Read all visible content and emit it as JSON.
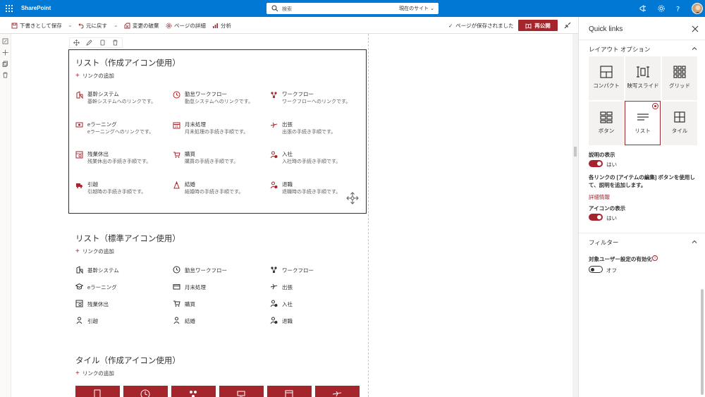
{
  "topbar": {
    "brand": "SharePoint",
    "search_placeholder": "検索",
    "search_scope": "現在のサイト"
  },
  "cmdbar": {
    "save_draft": "下書きとして保存",
    "undo": "元に戻す",
    "discard": "変更の破棄",
    "page_details": "ページの詳細",
    "analytics": "分析",
    "saved_status": "ページが保存されました",
    "republish": "再公開"
  },
  "section1": {
    "title": "リスト（作成アイコン使用）",
    "add_link": "リンクの追加",
    "items": [
      {
        "title": "基幹システム",
        "desc": "基幹システムへのリンクです。",
        "icon": "building-icon"
      },
      {
        "title": "勤怠ワークフロー",
        "desc": "勤怠システムへのリンクです。",
        "icon": "clock-icon"
      },
      {
        "title": "ワークフロー",
        "desc": "ワークフローへのリンクです。",
        "icon": "workflow-icon"
      },
      {
        "title": "eラーニング",
        "desc": "eラーニングへのリンクです。",
        "icon": "elearning-icon"
      },
      {
        "title": "月末処理",
        "desc": "月末処理の手続き手順です。",
        "icon": "calendar-icon"
      },
      {
        "title": "出張",
        "desc": "出張の手続き手順です。",
        "icon": "airplane-icon"
      },
      {
        "title": "残業休出",
        "desc": "残業休出の手続き手順です。",
        "icon": "overtime-icon"
      },
      {
        "title": "購買",
        "desc": "購買の手続き手順です。",
        "icon": "cart-icon"
      },
      {
        "title": "入社",
        "desc": "入社時の手続き手順です。",
        "icon": "person-add-icon"
      },
      {
        "title": "引越",
        "desc": "引越時の手続き手順です。",
        "icon": "truck-icon"
      },
      {
        "title": "結婚",
        "desc": "結婚時の手続き手順です。",
        "icon": "wedding-icon"
      },
      {
        "title": "退職",
        "desc": "退職時の手続き手順です。",
        "icon": "person-remove-icon"
      }
    ]
  },
  "section2": {
    "title": "リスト（標準アイコン使用）",
    "add_link": "リンクの追加",
    "items": [
      {
        "title": "基幹システム",
        "icon": "building-icon"
      },
      {
        "title": "勤怠ワークフロー",
        "icon": "clock-icon"
      },
      {
        "title": "ワークフロー",
        "icon": "workflow-icon"
      },
      {
        "title": "eラーニング",
        "icon": "graduation-cap-icon"
      },
      {
        "title": "月末処理",
        "icon": "card-icon"
      },
      {
        "title": "出張",
        "icon": "airplane-icon"
      },
      {
        "title": "残業休出",
        "icon": "overtime-icon"
      },
      {
        "title": "購買",
        "icon": "cart-icon"
      },
      {
        "title": "入社",
        "icon": "person-add-icon"
      },
      {
        "title": "引越",
        "icon": "person-icon"
      },
      {
        "title": "結婚",
        "icon": "person-icon"
      },
      {
        "title": "退職",
        "icon": "person-remove-icon"
      }
    ]
  },
  "section3": {
    "title": "タイル（作成アイコン使用）",
    "add_link": "リンクの追加"
  },
  "panel": {
    "title": "Quick links",
    "layout_header": "レイアウト オプション",
    "layouts": [
      {
        "label": "コンパクト",
        "icon": "compact-icon",
        "selected": false
      },
      {
        "label": "映写スライド",
        "icon": "filmstrip-icon",
        "selected": false
      },
      {
        "label": "グリッド",
        "icon": "grid-icon",
        "selected": false
      },
      {
        "label": "ボタン",
        "icon": "buttons-icon",
        "selected": false
      },
      {
        "label": "リスト",
        "icon": "list-icon",
        "selected": true
      },
      {
        "label": "タイル",
        "icon": "tiles-icon",
        "selected": false
      }
    ],
    "show_desc_label": "説明の表示",
    "show_desc_value": "はい",
    "help_text": "各リンクの [アイテムの編集] ボタンを使用して、説明を追加します。",
    "more_info": "詳細情報",
    "show_icon_label": "アイコンの表示",
    "show_icon_value": "はい",
    "filter_header": "フィルター",
    "audience_label": "対象ユーザー設定の有効化",
    "audience_value": "オフ"
  },
  "colors": {
    "brand_blue": "#0078d4",
    "accent_red": "#a4262c"
  }
}
